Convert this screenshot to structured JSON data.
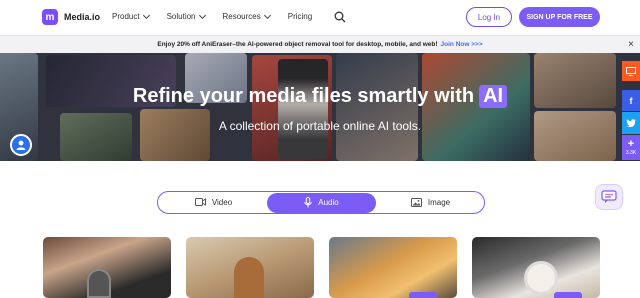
{
  "brand": {
    "name": "Media.io",
    "mark": "m"
  },
  "nav": {
    "items": [
      {
        "label": "Product",
        "has_dropdown": true
      },
      {
        "label": "Solution",
        "has_dropdown": true
      },
      {
        "label": "Resources",
        "has_dropdown": true
      },
      {
        "label": "Pricing",
        "has_dropdown": false
      }
    ],
    "login_label": "Log In",
    "signup_label": "SIGN UP FOR FREE"
  },
  "promo": {
    "text": "Enjoy 20% off AniEraser–the AI-powered object removal tool for desktop, mobile, and web!",
    "link": "Join Now >>>",
    "close": "×"
  },
  "hero": {
    "title": "Refine your media files smartly with",
    "title_badge": "AI",
    "subtitle": "A collection of portable online AI tools."
  },
  "social": {
    "facebook": "f",
    "share": "+",
    "share_count": "3.3K"
  },
  "tabs": [
    {
      "label": "Video",
      "icon": "video-icon",
      "active": false
    },
    {
      "label": "Audio",
      "icon": "microphone-icon",
      "active": true
    },
    {
      "label": "Image",
      "icon": "image-icon",
      "active": false
    }
  ],
  "colors": {
    "accent": "#7b5cf6",
    "promo_link": "#4a6cf7",
    "social_top": "#ff5a1f",
    "facebook": "#3b5ee6",
    "twitter": "#1da1f2"
  }
}
